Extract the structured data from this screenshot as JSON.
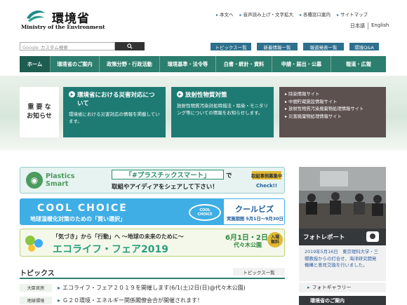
{
  "header": {
    "logo_jp": "環境省",
    "logo_en": "Ministry of the Environment",
    "utility_links": [
      "本文へ",
      "音声読み上げ・文字拡大",
      "各種窓口案内",
      "サイトマップ"
    ],
    "languages": [
      "日本語",
      "English"
    ]
  },
  "search": {
    "brand": "Google",
    "placeholder": "カスタム検索"
  },
  "quick_buttons": [
    "トピックス一覧",
    "新着情報一覧",
    "報道発表一覧",
    "環境Q&A"
  ],
  "nav": [
    "ホーム",
    "環境省のご案内",
    "政策分野・行政活動",
    "環境基準・法令等",
    "白書・統計・資料",
    "申請・届出・公募",
    "報道・広報"
  ],
  "hero": {
    "label": "重 要 な\nお知らせ",
    "box1": {
      "title": "環境省における災害対応について",
      "desc": "環境省における災害対応の情報を掲載しています。"
    },
    "box2": {
      "title": "放射性物質対策",
      "desc": "放射性物質汚染対処特措法・除染・モニタリング等についての情報をお知らせします。"
    },
    "links": [
      "除染情報サイト",
      "中間貯蔵施設情報サイト",
      "放射性物質汚染廃棄物処理情報サイト",
      "災害廃棄物処理情報サイト"
    ]
  },
  "banners": {
    "plastics": {
      "logo_text": "Plastics\nSmart",
      "main": "「#プラスチックスマート」",
      "de": "で",
      "sub": "取組やアイディアをシェアして下さい！",
      "badge": "取組事例募集中",
      "check": "Check!!"
    },
    "coolchoice": {
      "title": "COOL CHOICE",
      "sub": "地球温暖化対策のための「賢い選択」",
      "logo": "COOL\nCHOICE",
      "biz": "クールビズ",
      "period": "実施期間 5月1日～9月30日"
    },
    "ecolife": {
      "top": "「気づき」から「行動」へ ～地球の未来のために～",
      "main": "エコライフ・フェア2019",
      "date": "6月1日・2日",
      "place": "代々木公園",
      "free": "入場\n無料"
    }
  },
  "topics": {
    "title": "トピックス",
    "list_link": "トピックス一覧",
    "items": [
      {
        "category": "大臣官房",
        "text": "エコライフ・フェア２０１９を開催します(6/1(土)2日(日)@代々木公園)"
      },
      {
        "category": "地球環境",
        "text": "Ｇ２０環境・エネルギー関係閣僚会合が開催されます！"
      }
    ]
  },
  "photo_report": {
    "header": "フォトレポート",
    "body": "2019年5月16日　東京理科大学・三幌教授からの打合せ、海洋研究開発機構と意見交換を行いました。",
    "gallery": "フォトギャラリー",
    "bottom": "環境省のご案内"
  },
  "colors": {
    "nav_green": "#2c7e6e",
    "teal_box": "#1e7b74",
    "links_box": "#5d5150",
    "quick_blue": "#2e6f8e"
  }
}
